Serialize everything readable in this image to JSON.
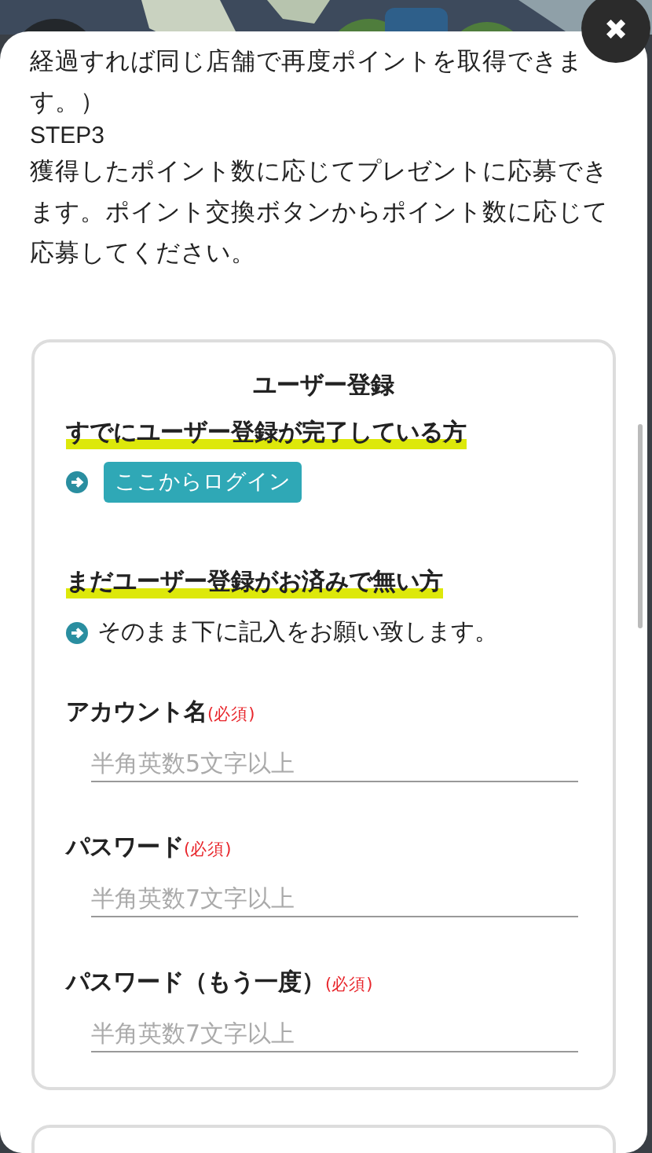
{
  "intro": {
    "lines": [
      "経過すれば同じ店舗で再度ポイントを取得できます。）",
      "STEP3",
      "獲得したポイント数に応じてプレゼントに応募できます。ポイント交換ボタンからポイント数に応じて応募してください。"
    ]
  },
  "close_button": {
    "label": "✖"
  },
  "registration": {
    "title": "ユーザー登録",
    "registered_heading": "すでにユーザー登録が完了している方",
    "login_button": "ここからログイン",
    "new_heading": "まだユーザー登録がお済みで無い方",
    "new_note": "そのまま下に記入をお願い致します。",
    "fields": [
      {
        "label": "アカウント名",
        "required": "(必須)",
        "placeholder": "半角英数5文字以上"
      },
      {
        "label": "パスワード",
        "required": "(必須)",
        "placeholder": "半角英数7文字以上"
      },
      {
        "label": "パスワード（もう一度）",
        "required": "(必須)",
        "placeholder": "半角英数7文字以上"
      }
    ]
  }
}
